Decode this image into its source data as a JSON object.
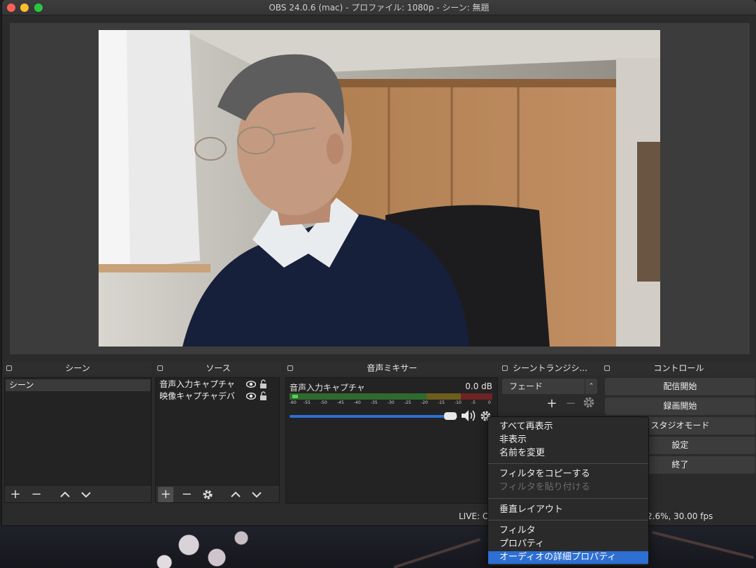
{
  "window": {
    "title": "OBS 24.0.6 (mac) - プロファイル: 1080p - シーン: 無題"
  },
  "docks": {
    "scenes": "シーン",
    "sources": "ソース",
    "mixer": "音声ミキサー",
    "transitions": "シーントランジシ...",
    "controls": "コントロール"
  },
  "scenes": {
    "items": [
      "シーン"
    ]
  },
  "sources": {
    "items": [
      {
        "label": "音声入力キャプチャ",
        "visible": true,
        "locked": false
      },
      {
        "label": "映像キャプチャデバ",
        "visible": true,
        "locked": false
      }
    ]
  },
  "mixer": {
    "channel_name": "音声入力キャプチャ",
    "volume_db": "0.0 dB",
    "scale": [
      "-60",
      "-55",
      "-50",
      "-45",
      "-40",
      "-35",
      "-30",
      "-25",
      "-20",
      "-15",
      "-10",
      "-5",
      "0"
    ],
    "volume_fraction": 1.0
  },
  "transitions": {
    "selected": "フェード"
  },
  "controls": {
    "start_streaming": "配信開始",
    "start_recording": "録画開始",
    "studio_mode": "スタジオモード",
    "settings": "設定",
    "exit": "終了"
  },
  "context_menu": {
    "show_all": "すべて再表示",
    "hide": "非表示",
    "rename": "名前を変更",
    "copy_filters": "フィルタをコピーする",
    "paste_filters": "フィルタを貼り付ける",
    "vertical_layout": "垂直レイアウト",
    "filters": "フィルタ",
    "properties": "プロパティ",
    "advanced_audio": "オーディオの詳細プロパティ"
  },
  "status": {
    "live": "LIVE: C",
    "stats": "2.6%, 30.00 fps"
  },
  "colors": {
    "accent_blue": "#2d6fd3",
    "meter_green": "#3fae3f",
    "meter_yellow": "#b59b2a",
    "meter_red": "#b63a3a"
  }
}
